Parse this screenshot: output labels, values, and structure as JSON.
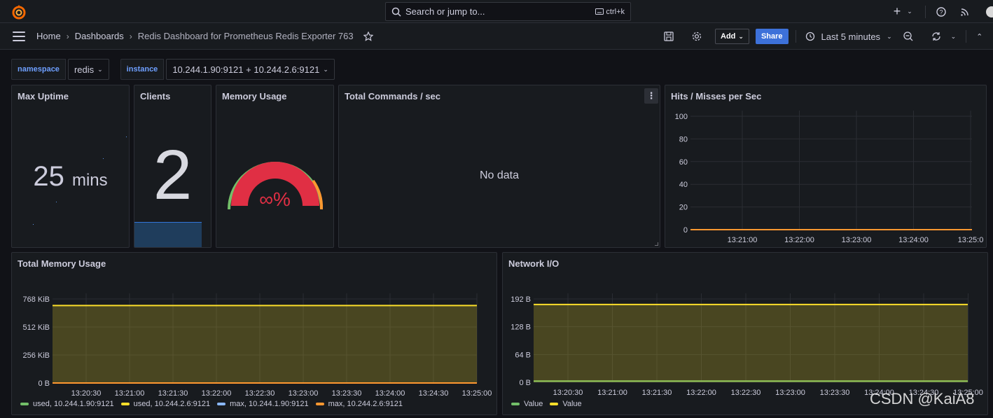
{
  "topbar": {
    "search_placeholder": "Search or jump to...",
    "shortcut": "ctrl+k",
    "icons": [
      "plus-icon",
      "chevron-down-icon",
      "help-icon",
      "rss-icon",
      "avatar"
    ]
  },
  "breadcrumb": {
    "home": "Home",
    "dashboards": "Dashboards",
    "current": "Redis Dashboard for Prometheus Redis Exporter 763"
  },
  "actions": {
    "add_label": "Add",
    "share_label": "Share",
    "time_range": "Last 5 minutes"
  },
  "variables": [
    {
      "label": "namespace",
      "value": "redis"
    },
    {
      "label": "instance",
      "value": "10.244.1.90:9121 + 10.244.2.6:9121"
    }
  ],
  "panels": {
    "uptime": {
      "title": "Max Uptime",
      "value": "25",
      "unit": "mins"
    },
    "clients": {
      "title": "Clients",
      "value": "2"
    },
    "memory": {
      "title": "Memory Usage",
      "value": "∞%"
    },
    "commands": {
      "title": "Total Commands / sec",
      "nodata": "No data",
      "menu_icon": "⋮"
    },
    "hits": {
      "title": "Hits / Misses per Sec"
    },
    "total_memory": {
      "title": "Total Memory Usage"
    },
    "network": {
      "title": "Network I/O"
    }
  },
  "colors": {
    "green": "#73bf69",
    "yellow": "#fade2a",
    "blue": "#8ab8ff",
    "orange": "#ff9830",
    "gauge_red": "#e02f44",
    "accent": "#3d71d9"
  },
  "chart_data": [
    {
      "type": "line",
      "title": "Hits / Misses per Sec",
      "x": [
        "13:21:00",
        "13:22:00",
        "13:23:00",
        "13:24:00",
        "13:25:0"
      ],
      "y_ticks": [
        "100",
        "80",
        "60",
        "40",
        "20",
        "0"
      ],
      "ylim": [
        0,
        100
      ],
      "series": [
        {
          "values": [
            0,
            0,
            0,
            0,
            0
          ]
        }
      ]
    },
    {
      "type": "area",
      "title": "Total Memory Usage",
      "x": [
        "13:20:30",
        "13:21:00",
        "13:21:30",
        "13:22:00",
        "13:22:30",
        "13:23:00",
        "13:23:30",
        "13:24:00",
        "13:24:30",
        "13:25:00"
      ],
      "y_ticks": [
        "768 KiB",
        "512 KiB",
        "256 KiB",
        "0 B"
      ],
      "ylim": [
        0,
        900
      ],
      "series": [
        {
          "name": "used, 10.244.1.90:9121",
          "values": [
            0,
            0,
            0,
            0,
            0,
            0,
            0,
            0,
            0,
            0
          ]
        },
        {
          "name": "used, 10.244.2.6:9121",
          "values": [
            830,
            830,
            830,
            830,
            830,
            830,
            830,
            830,
            830,
            830
          ]
        },
        {
          "name": "max, 10.244.1.90:9121",
          "values": [
            0,
            0,
            0,
            0,
            0,
            0,
            0,
            0,
            0,
            0
          ]
        },
        {
          "name": "max, 10.244.2.6:9121",
          "values": [
            0,
            0,
            0,
            0,
            0,
            0,
            0,
            0,
            0,
            0
          ]
        }
      ]
    },
    {
      "type": "area",
      "title": "Network I/O",
      "x": [
        "13:20:30",
        "13:21:00",
        "13:21:30",
        "13:22:00",
        "13:22:30",
        "13:23:00",
        "13:23:30",
        "13:24:00",
        "13:24:30",
        "13:25:00"
      ],
      "y_ticks": [
        "192 B",
        "128 B",
        "64 B",
        "0 B"
      ],
      "ylim": [
        0,
        210
      ],
      "series": [
        {
          "name": "Value",
          "values": [
            3,
            3,
            3,
            3,
            3,
            3,
            3,
            3,
            3,
            3
          ]
        },
        {
          "name": "Value",
          "values": [
            196,
            196,
            196,
            196,
            196,
            196,
            196,
            196,
            196,
            196
          ]
        }
      ]
    }
  ],
  "watermark": "CSDN @KaiA8"
}
